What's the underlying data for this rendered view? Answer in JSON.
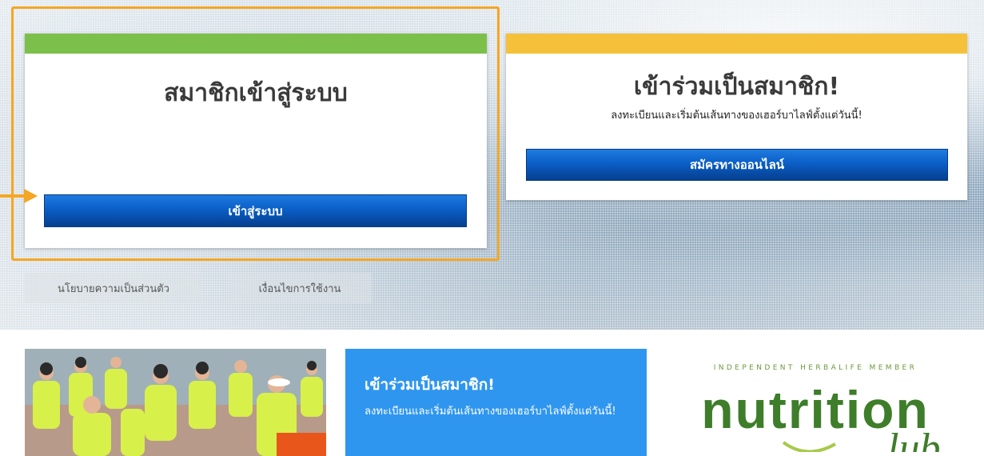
{
  "login_card": {
    "title": "สมาชิกเข้าสู่ระบบ",
    "button_label": "เข้าสู่ระบบ"
  },
  "join_card": {
    "title": "เข้าร่วมเป็นสมาชิก!",
    "subtitle": "ลงทะเบียนและเริ่มต้นเส้นทางของเฮอร์บาไลฟ์ตั้งแต่วันนี้!",
    "button_label": "สมัครทางออนไลน์"
  },
  "footer_links": {
    "privacy": "นโยบายความเป็นส่วนตัว",
    "terms": "เงื่อนไขการใช้งาน"
  },
  "promo": {
    "title": "เข้าร่วมเป็นสมาชิก!",
    "subtitle": "ลงทะเบียนและเริ่มต้นเส้นทางของเฮอร์บาไลฟ์ตั้งแต่วันนี้!"
  },
  "logo": {
    "tagline": "INDEPENDENT HERBALIFE MEMBER",
    "wordmark": "nutrition"
  },
  "colors": {
    "green_bar": "#7cc04b",
    "yellow_bar": "#f5c13a",
    "button_blue": "#0a5fc7",
    "highlight_orange": "#f5a623",
    "promo_blue": "#2f96f0",
    "logo_green": "#3e7d2a"
  }
}
